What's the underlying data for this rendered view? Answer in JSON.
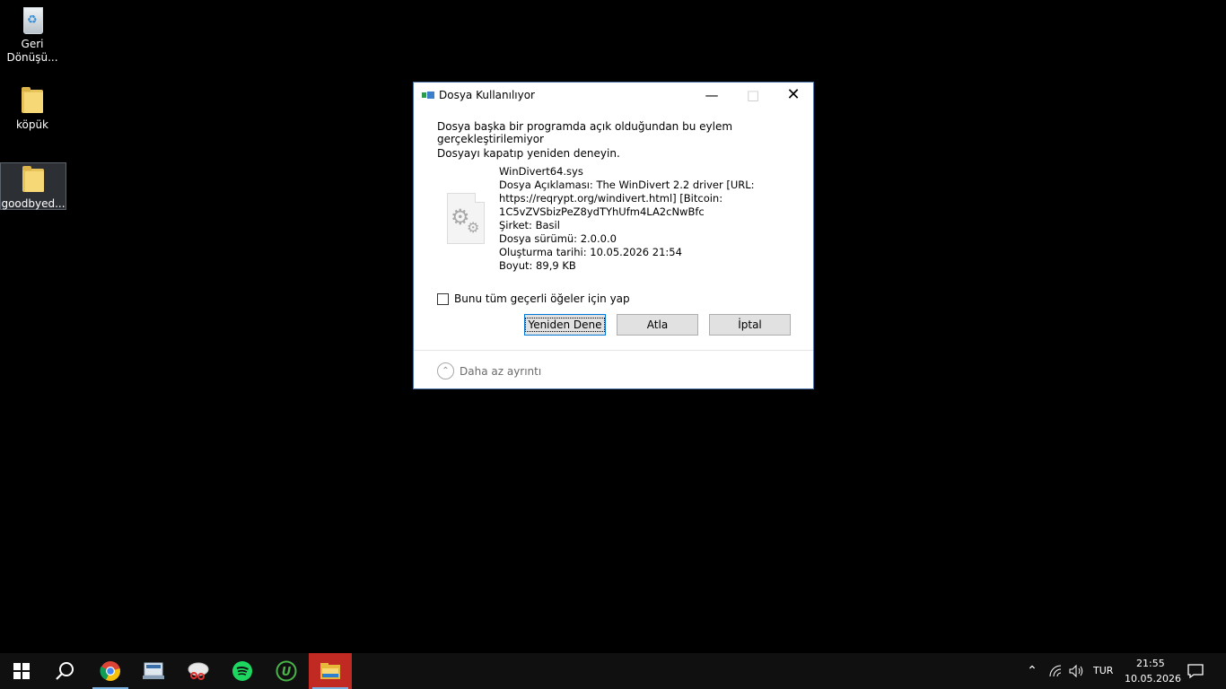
{
  "desktop": {
    "icons": [
      {
        "label": "Geri\nDönüşü...",
        "line1": "Geri",
        "line2": "Dönüşü...",
        "icon": "recycle-bin-icon"
      },
      {
        "label": "köpük",
        "icon": "folder-icon"
      },
      {
        "label": "goodbyed...",
        "icon": "folder-icon"
      }
    ]
  },
  "dialog": {
    "title": "Dosya Kullanılıyor",
    "message": "Dosya başka bir programda açık olduğundan bu eylem gerçekleştirilemiyor",
    "instruction": "Dosyayı kapatıp yeniden deneyin.",
    "file": {
      "name": "WinDivert64.sys",
      "description_line1": "Dosya Açıklaması: The WinDivert 2.2 driver [URL:",
      "description_line2": "https://reqrypt.org/windivert.html] [Bitcoin:",
      "description_line3": "1C5vZVSbizPeZ8ydTYhUfm4LA2cNwBfc",
      "company": "Şirket: Basil",
      "version": "Dosya sürümü: 2.0.0.0",
      "created": "Oluşturma tarihi: 10.05.2026 21:54",
      "size": "Boyut: 89,9 KB"
    },
    "checkbox_label": "Bunu tüm geçerli öğeler için yap",
    "buttons": {
      "retry": "Yeniden Dene",
      "skip": "Atla",
      "cancel": "İptal"
    },
    "less_details": "Daha az ayrıntı"
  },
  "taskbar": {
    "apps": [
      "start-icon",
      "search-icon",
      "chrome-icon",
      "network-app-icon",
      "snipping-icon",
      "spotify-icon",
      "utorrent-icon",
      "file-explorer-icon"
    ],
    "tray": {
      "language": "TUR",
      "time": "21:55",
      "date": "10.05.2026"
    }
  },
  "colors": {
    "accent": "#0078d7",
    "active_task": "#c12a22",
    "spotify": "#1ed760",
    "utorrent": "#49b548"
  }
}
